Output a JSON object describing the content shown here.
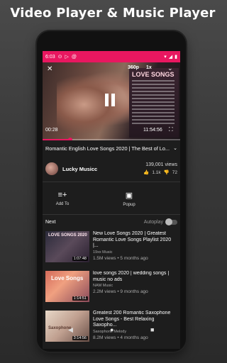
{
  "headline": "Video Player & Music Player",
  "status_bar": {
    "time": "6:03",
    "icons": [
      "app-notification-icon",
      "play-store-icon",
      "at-icon"
    ],
    "right_icons": [
      "wifi-icon",
      "signal-icon",
      "battery-icon"
    ]
  },
  "player": {
    "quality": "360p",
    "speed": "1x",
    "time_elapsed": "00:28",
    "time_total": "11:54:56",
    "progress_fraction": 0.2,
    "poster_text": "LOVE SONGS",
    "brand_accent": "#e81760"
  },
  "video_info": {
    "title": "Romantic English Love Songs 2020 | The Best of Lo...",
    "channel_name": "Lucky Musicc",
    "views": "139,001 views",
    "likes": "1.1k",
    "dislikes": "72"
  },
  "actions": [
    {
      "label": "Add To",
      "icon": "playlist-add-icon"
    },
    {
      "label": "Popup",
      "icon": "popup-icon"
    }
  ],
  "next_section": {
    "label": "Next",
    "autoplay_label": "Autoplay",
    "autoplay_on": false
  },
  "up_next": [
    {
      "thumb_text": "LOVE SONGS 2020",
      "duration": "1:07:48",
      "title": "New Love Songs 2020 | Greatest Romantic Love Songs Playlist 2020 |...",
      "channel": "19xx Music",
      "meta": "1.5M views • 5 months ago"
    },
    {
      "thumb_text": "Love Songs",
      "duration": "1:14:51",
      "title": "love songs 2020 | wedding songs | music no ads",
      "channel": "NAM Music",
      "meta": "2.2M views • 9 months ago"
    },
    {
      "thumb_text": "Saxophone",
      "duration": "3:14:56",
      "title": "Greatest 200 Romantic Saxophone Love Songs - Best Relaxing Saxopho...",
      "channel": "Saxophone Melody",
      "meta": "8.2M views • 4 months ago"
    }
  ]
}
